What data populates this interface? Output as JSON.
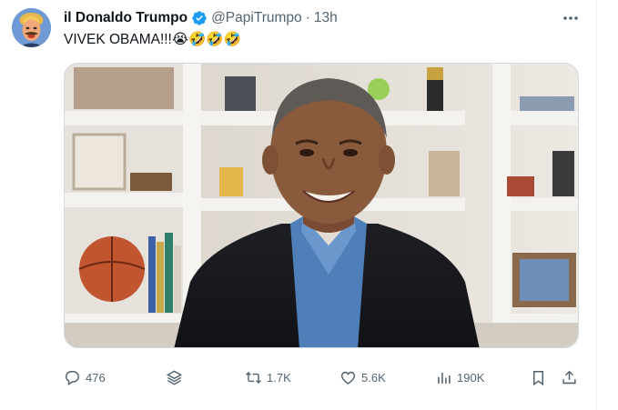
{
  "post": {
    "display_name": "il Donaldo Trumpo",
    "handle": "@PapiTrumpo",
    "separator": "·",
    "time": "13h",
    "text": "VIVEK OBAMA!!!😭🤣🤣🤣"
  },
  "actions": {
    "replies": "476",
    "reposts": "1.7K",
    "likes": "5.6K",
    "views": "190K"
  },
  "icons": [
    "avatar",
    "verified-badge-icon",
    "more-icon",
    "reply-icon",
    "stack-icon",
    "repost-icon",
    "like-icon",
    "views-icon",
    "bookmark-icon",
    "share-icon"
  ],
  "colors": {
    "text": "#0f1419",
    "muted": "#536471",
    "verified": "#1d9bf0"
  }
}
